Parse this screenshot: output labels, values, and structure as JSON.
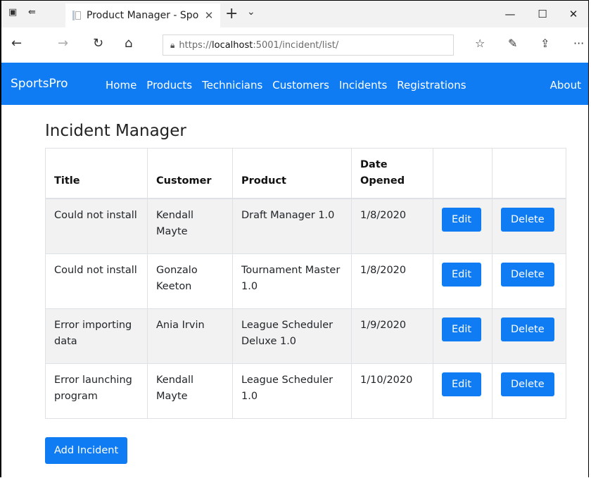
{
  "browser": {
    "tab_title": "Product Manager - Spo",
    "tab_close": "✕",
    "new_tab": "+",
    "tab_menu": "⌄",
    "minimize": "—",
    "maximize": "☐",
    "close": "✕",
    "url_prefix": "https://",
    "url_host": "localhost",
    "url_rest": ":5001/incident/list/",
    "more": "···"
  },
  "navbar": {
    "brand": "SportsPro",
    "links": [
      "Home",
      "Products",
      "Technicians",
      "Customers",
      "Incidents",
      "Registrations"
    ],
    "about": "About"
  },
  "page": {
    "title": "Incident Manager",
    "columns": [
      "Title",
      "Customer",
      "Product",
      "Date Opened",
      "",
      ""
    ],
    "rows": [
      {
        "title": "Could not install",
        "customer": "Kendall Mayte",
        "product": "Draft Manager 1.0",
        "date": "1/8/2020"
      },
      {
        "title": "Could not install",
        "customer": "Gonzalo Keeton",
        "product": "Tournament Master 1.0",
        "date": "1/8/2020"
      },
      {
        "title": "Error importing data",
        "customer": "Ania Irvin",
        "product": "League Scheduler Deluxe 1.0",
        "date": "1/9/2020"
      },
      {
        "title": "Error launching program",
        "customer": "Kendall Mayte",
        "product": "League Scheduler 1.0",
        "date": "1/10/2020"
      }
    ],
    "edit_label": "Edit",
    "delete_label": "Delete",
    "add_label": "Add Incident"
  },
  "colors": {
    "primary": "#0f7cf4",
    "stripe": "#f2f2f2",
    "border": "#dee2e6"
  }
}
